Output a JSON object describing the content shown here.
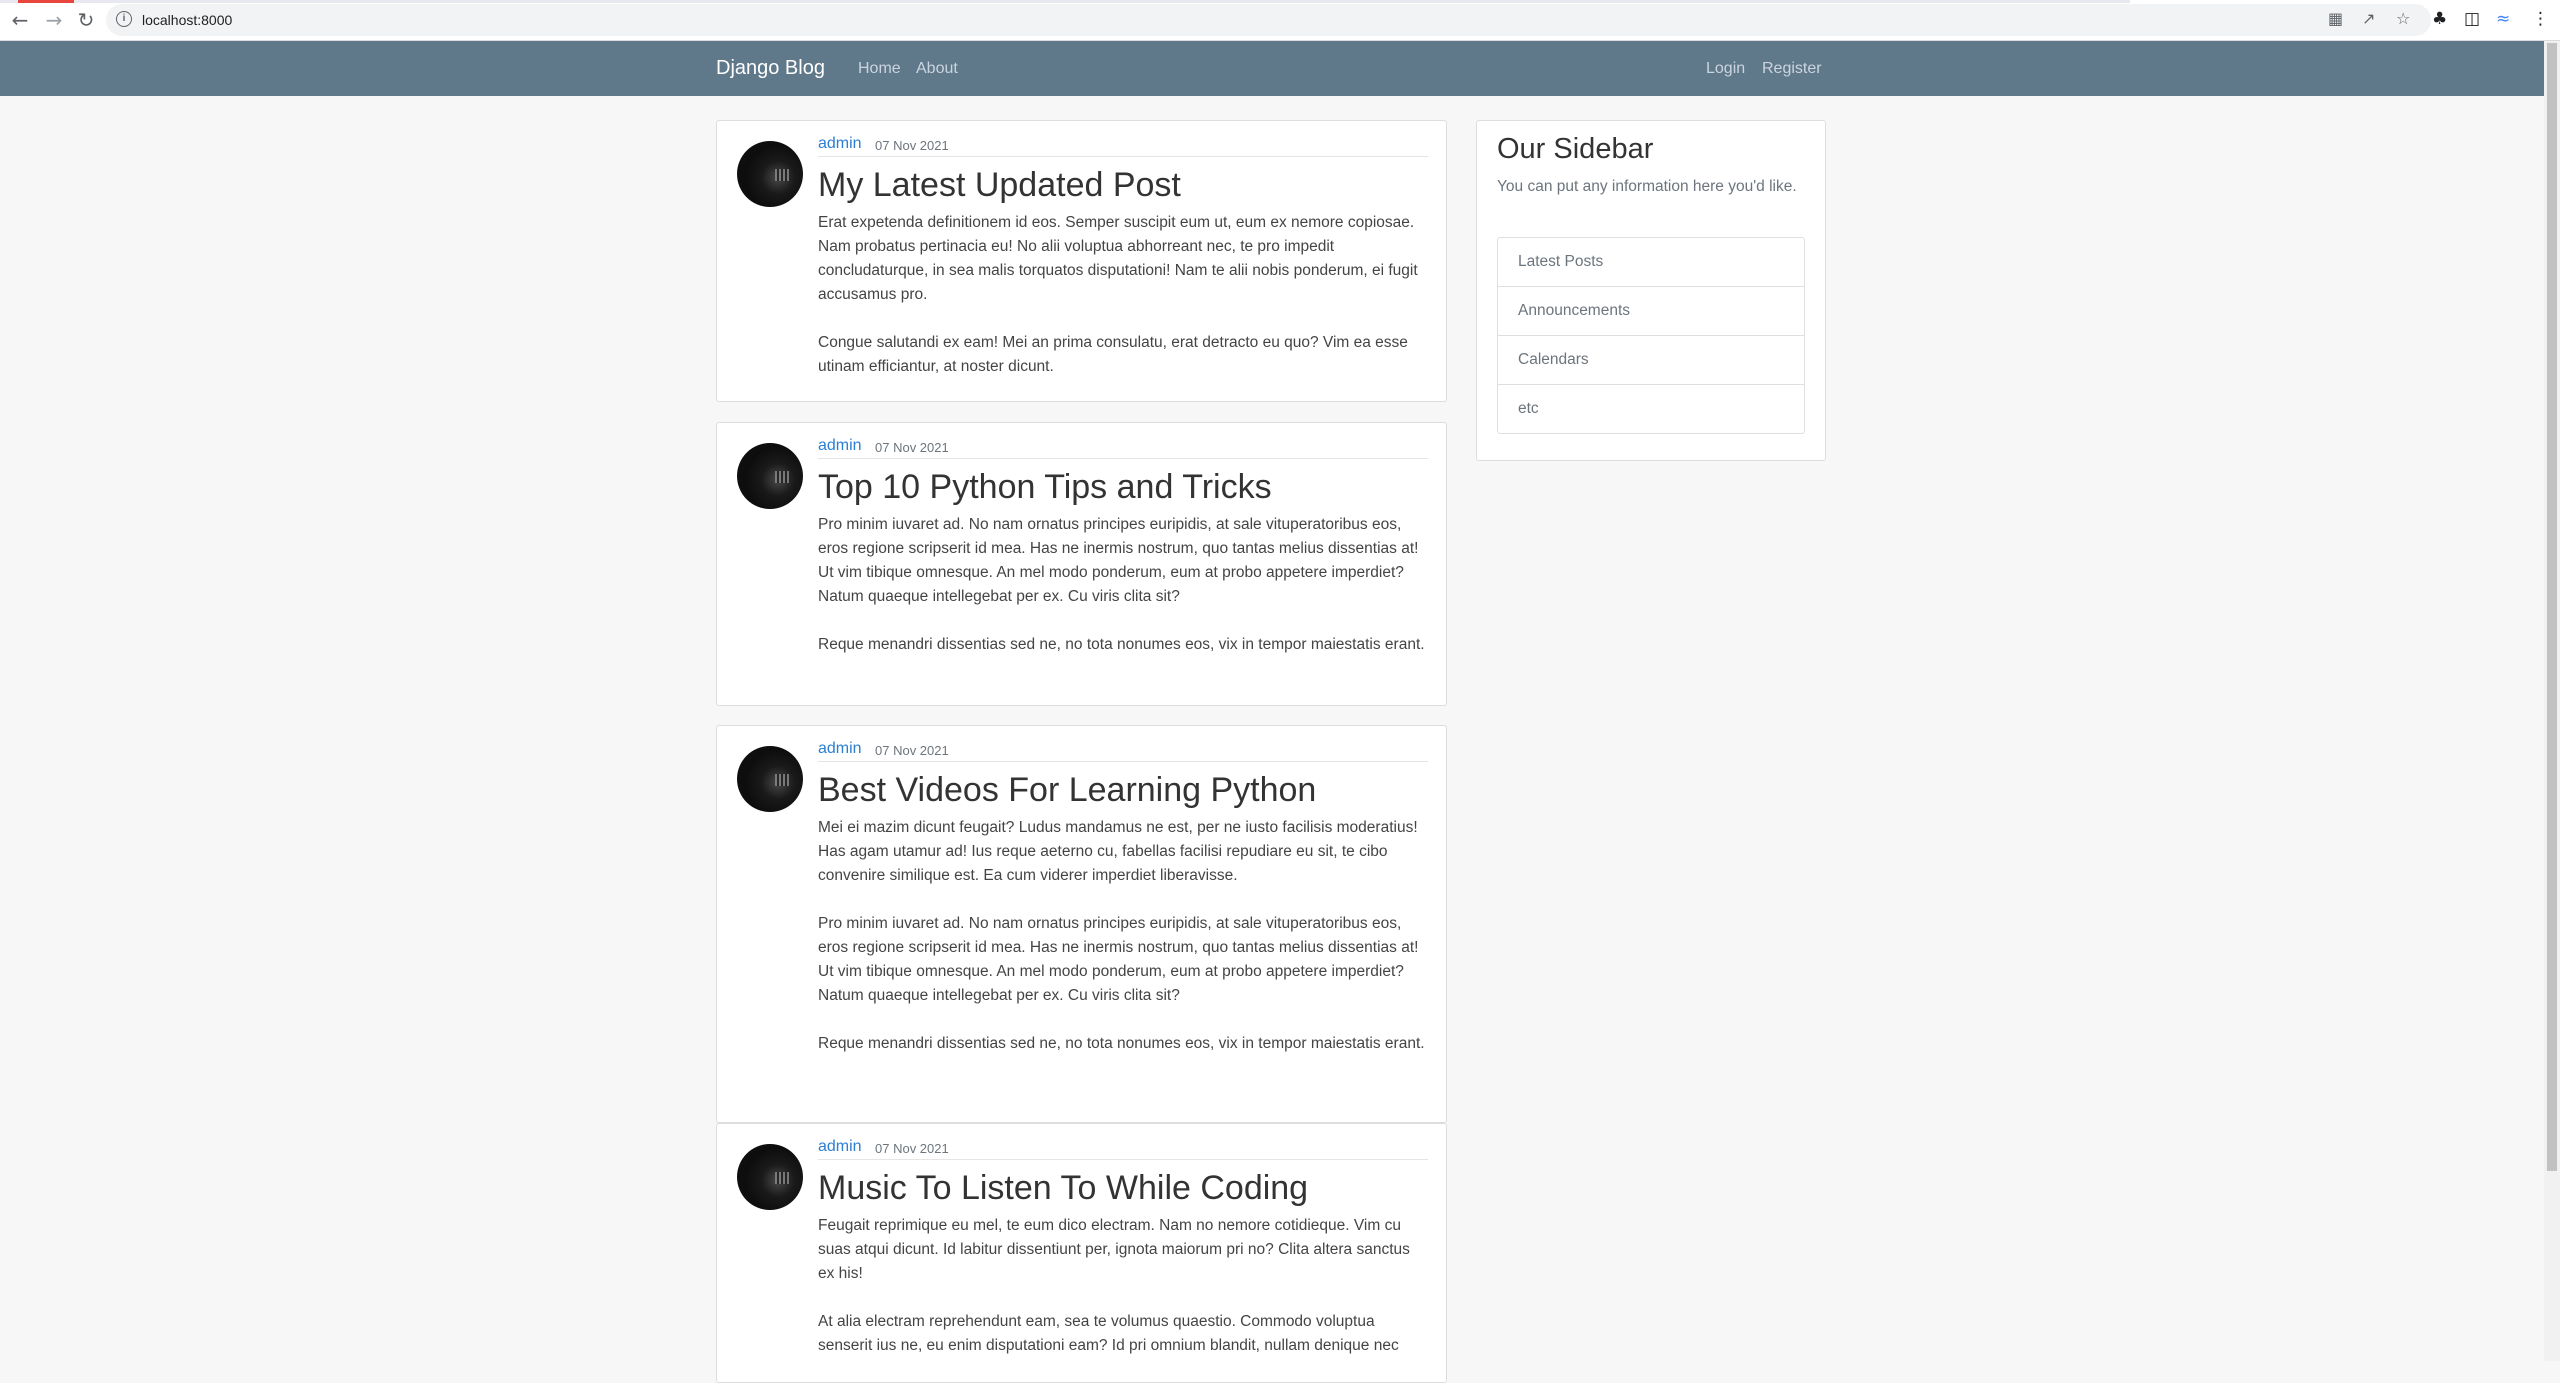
{
  "browser": {
    "url": "localhost:8000"
  },
  "navbar": {
    "brand": "Django Blog",
    "links": [
      "Home",
      "About"
    ],
    "auth_links": [
      "Login",
      "Register"
    ]
  },
  "posts": [
    {
      "author": "admin",
      "date": "07 Nov 2021",
      "title": "My Latest Updated Post",
      "paragraphs": [
        "Erat expetenda definitionem id eos. Semper suscipit eum ut, eum ex nemore copiosae. Nam probatus pertinacia eu! No alii voluptua abhorreant nec, te pro impedit concludaturque, in sea malis torquatos disputationi! Nam te alii nobis ponderum, ei fugit accusamus pro.",
        "Congue salutandi ex eam! Mei an prima consulatu, erat detracto eu quo? Vim ea esse utinam efficiantur, at noster dicunt."
      ]
    },
    {
      "author": "admin",
      "date": "07 Nov 2021",
      "title": "Top 10 Python Tips and Tricks",
      "paragraphs": [
        "Pro minim iuvaret ad. No nam ornatus principes euripidis, at sale vituperatoribus eos, eros regione scripserit id mea. Has ne inermis nostrum, quo tantas melius dissentias at! Ut vim tibique omnesque. An mel modo ponderum, eum at probo appetere imperdiet? Natum quaeque intellegebat per ex. Cu viris clita sit?",
        "Reque menandri dissentias sed ne, no tota nonumes eos, vix in tempor maiestatis erant."
      ]
    },
    {
      "author": "admin",
      "date": "07 Nov 2021",
      "title": "Best Videos For Learning Python",
      "paragraphs": [
        "Mei ei mazim dicunt feugait? Ludus mandamus ne est, per ne iusto facilisis moderatius! Has agam utamur ad! Ius reque aeterno cu, fabellas facilisi repudiare eu sit, te cibo convenire similique est. Ea cum viderer imperdiet liberavisse.",
        "Pro minim iuvaret ad. No nam ornatus principes euripidis, at sale vituperatoribus eos, eros regione scripserit id mea. Has ne inermis nostrum, quo tantas melius dissentias at! Ut vim tibique omnesque. An mel modo ponderum, eum at probo appetere imperdiet? Natum quaeque intellegebat per ex. Cu viris clita sit?",
        "Reque menandri dissentias sed ne, no tota nonumes eos, vix in tempor maiestatis erant."
      ]
    },
    {
      "author": "admin",
      "date": "07 Nov 2021",
      "title": "Music To Listen To While Coding",
      "paragraphs": [
        "Feugait reprimique eu mel, te eum dico electram. Nam no nemore cotidieque. Vim cu suas atqui dicunt. Id labitur dissentiunt per, ignota maiorum pri no? Clita altera sanctus ex his!",
        "At alia electram reprehendunt eam, sea te volumus quaestio. Commodo voluptua senserit ius ne, eu enim disputationi eam? Id pri omnium blandit, nullam denique nec"
      ]
    }
  ],
  "sidebar": {
    "title": "Our Sidebar",
    "description": "You can put any information here you'd like.",
    "items": [
      "Latest Posts",
      "Announcements",
      "Calendars",
      "etc"
    ]
  }
}
